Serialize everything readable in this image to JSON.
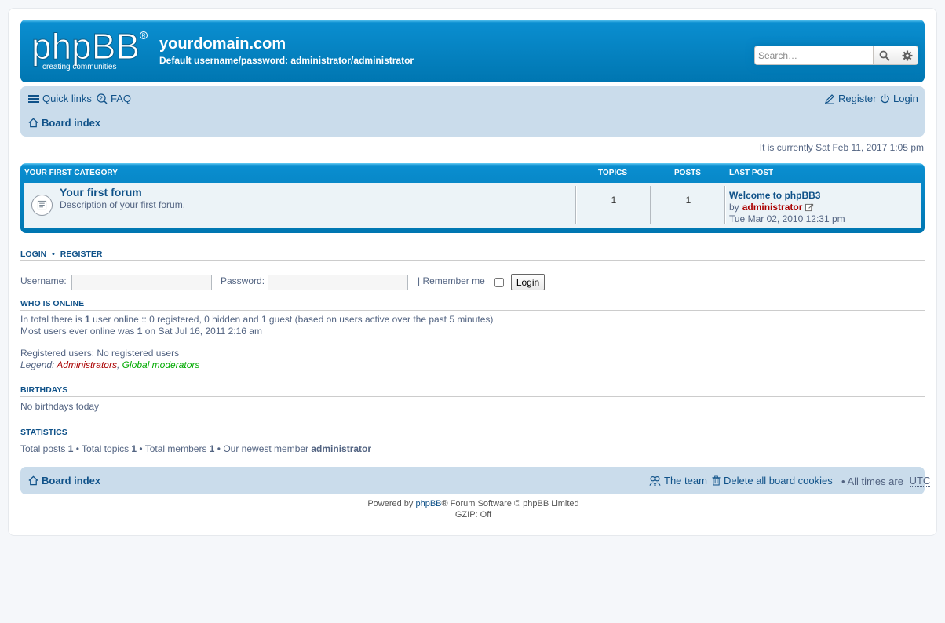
{
  "header": {
    "logo_text": "phpBB",
    "logo_tagline": "creating communities",
    "site_title": "yourdomain.com",
    "site_description": "Default username/password: administrator/administrator",
    "search_placeholder": "Search…"
  },
  "navbar": {
    "quick_links": "Quick links",
    "faq": "FAQ",
    "register": "Register",
    "login": "Login",
    "breadcrumb": "Board index"
  },
  "current_time": "It is currently Sat Feb 11, 2017 1:05 pm",
  "forumlist": {
    "category": "Your first category",
    "col_topics": "Topics",
    "col_posts": "Posts",
    "col_last_post": "Last post",
    "rows": [
      {
        "name": "Your first forum",
        "description": "Description of your first forum.",
        "topics": "1",
        "posts": "1",
        "last_post_title": "Welcome to phpBB3",
        "last_post_by": "by",
        "last_post_author": "administrator",
        "last_post_date": "Tue Mar 02, 2010 12:31 pm"
      }
    ]
  },
  "login_section": {
    "heading_login": "Login",
    "heading_sep": "•",
    "heading_register": "Register",
    "username_label": "Username:",
    "password_label": "Password:",
    "remember_label": "| Remember me",
    "button": "Login"
  },
  "who_is_online": {
    "heading": "Who is online",
    "line1_a": "In total there is ",
    "line1_count": "1",
    "line1_b": " user online :: 0 registered, 0 hidden and 1 guest (based on users active over the past 5 minutes)",
    "line2_a": "Most users ever online was ",
    "line2_count": "1",
    "line2_b": " on Sat Jul 16, 2011 2:16 am",
    "registered_users": "Registered users: No registered users",
    "legend_label": "Legend:",
    "legend_admins": "Administrators",
    "legend_comma": ",",
    "legend_mods": "Global moderators"
  },
  "birthdays": {
    "heading": "Birthdays",
    "text": "No birthdays today"
  },
  "statistics": {
    "heading": "Statistics",
    "posts_label": "Total posts ",
    "posts": "1",
    "topics_label": " • Total topics ",
    "topics": "1",
    "members_label": " • Total members ",
    "members": "1",
    "newest_label": " • Our newest member ",
    "newest": "administrator"
  },
  "footer": {
    "board_index": "Board index",
    "the_team": "The team",
    "delete_cookies": "Delete all board cookies",
    "times_label": "• All times are ",
    "timezone": "UTC",
    "powered_a": "Powered by ",
    "powered_link": "phpBB",
    "powered_b": "® Forum Software © phpBB Limited",
    "gzip": "GZIP: Off"
  },
  "colors": {
    "header_blue": "#0076b1",
    "navbar_bg": "#cadceb",
    "link": "#105289",
    "admin_red": "#aa0000",
    "mod_green": "#00aa00"
  }
}
